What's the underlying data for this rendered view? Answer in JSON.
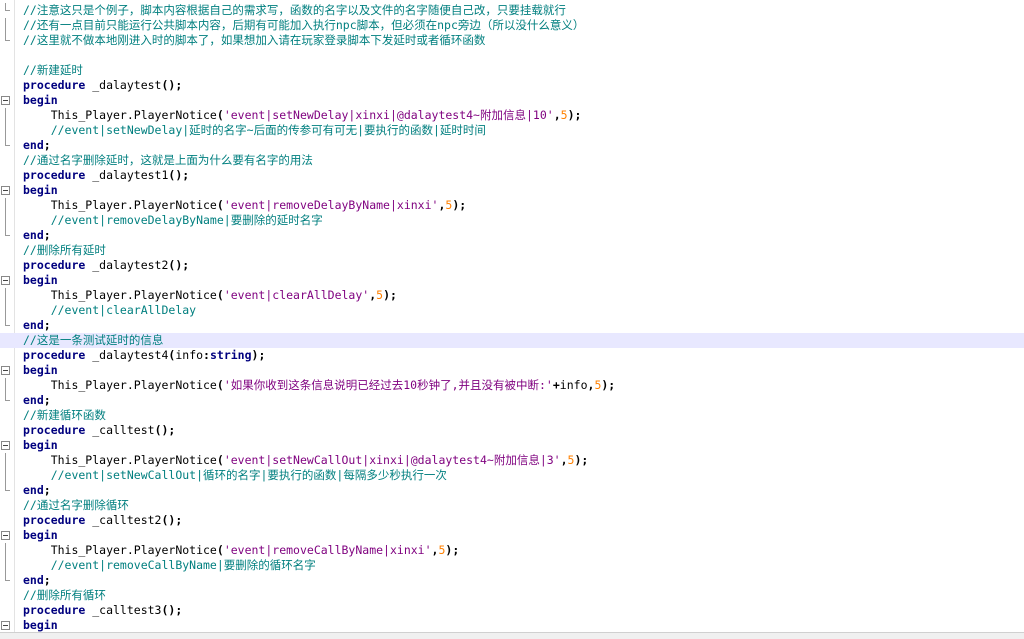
{
  "editor": {
    "lines": [
      {
        "fold": "corner",
        "hl": false,
        "tokens": [
          [
            "cm",
            "//注意这只是个例子，脚本内容根据自己的需求写，函数的名字以及文件的名字随便自己改，只要挂载就行"
          ]
        ]
      },
      {
        "fold": "bar",
        "hl": false,
        "tokens": [
          [
            "cm",
            "//还有一点目前只能运行公共脚本内容，后期有可能加入执行npc脚本，但必须在npc旁边（所以没什么意义）"
          ]
        ]
      },
      {
        "fold": "corner",
        "hl": false,
        "tokens": [
          [
            "cm",
            "//这里就不做本地刚进入时的脚本了，如果想加入请在玩家登录脚本下发延时或者循环函数"
          ]
        ]
      },
      {
        "fold": "",
        "hl": false,
        "tokens": []
      },
      {
        "fold": "",
        "hl": false,
        "tokens": [
          [
            "cm",
            "//新建延时"
          ]
        ]
      },
      {
        "fold": "",
        "hl": false,
        "tokens": [
          [
            "kw",
            "procedure"
          ],
          [
            "id",
            " _dalaytest"
          ],
          [
            "op",
            "();"
          ]
        ]
      },
      {
        "fold": "box",
        "hl": false,
        "tokens": [
          [
            "kw",
            "begin"
          ]
        ]
      },
      {
        "fold": "bar",
        "hl": false,
        "tokens": [
          [
            "id",
            "    This_Player.PlayerNotice"
          ],
          [
            "op",
            "("
          ],
          [
            "str",
            "'event|setNewDelay|xinxi|@dalaytest4~附加信息|10'"
          ],
          [
            "op",
            ","
          ],
          [
            "num",
            "5"
          ],
          [
            "op",
            ");"
          ]
        ]
      },
      {
        "fold": "bar",
        "hl": false,
        "tokens": [
          [
            "cm",
            "    //event|setNewDelay|延时的名字~后面的传参可有可无|要执行的函数|延时时间"
          ]
        ]
      },
      {
        "fold": "corner",
        "hl": false,
        "tokens": [
          [
            "kw",
            "end"
          ],
          [
            "op",
            ";"
          ]
        ]
      },
      {
        "fold": "",
        "hl": false,
        "tokens": [
          [
            "cm",
            "//通过名字删除延时，这就是上面为什么要有名字的用法"
          ]
        ]
      },
      {
        "fold": "",
        "hl": false,
        "tokens": [
          [
            "kw",
            "procedure"
          ],
          [
            "id",
            " _dalaytest1"
          ],
          [
            "op",
            "();"
          ]
        ]
      },
      {
        "fold": "box",
        "hl": false,
        "tokens": [
          [
            "kw",
            "begin"
          ]
        ]
      },
      {
        "fold": "bar",
        "hl": false,
        "tokens": [
          [
            "id",
            "    This_Player.PlayerNotice"
          ],
          [
            "op",
            "("
          ],
          [
            "str",
            "'event|removeDelayByName|xinxi'"
          ],
          [
            "op",
            ","
          ],
          [
            "num",
            "5"
          ],
          [
            "op",
            ");"
          ]
        ]
      },
      {
        "fold": "bar",
        "hl": false,
        "tokens": [
          [
            "cm",
            "    //event|removeDelayByName|要删除的延时名字"
          ]
        ]
      },
      {
        "fold": "corner",
        "hl": false,
        "tokens": [
          [
            "kw",
            "end"
          ],
          [
            "op",
            ";"
          ]
        ]
      },
      {
        "fold": "",
        "hl": false,
        "tokens": [
          [
            "cm",
            "//删除所有延时"
          ]
        ]
      },
      {
        "fold": "",
        "hl": false,
        "tokens": [
          [
            "kw",
            "procedure"
          ],
          [
            "id",
            " _dalaytest2"
          ],
          [
            "op",
            "();"
          ]
        ]
      },
      {
        "fold": "box",
        "hl": false,
        "tokens": [
          [
            "kw",
            "begin"
          ]
        ]
      },
      {
        "fold": "bar",
        "hl": false,
        "tokens": [
          [
            "id",
            "    This_Player.PlayerNotice"
          ],
          [
            "op",
            "("
          ],
          [
            "str",
            "'event|clearAllDelay'"
          ],
          [
            "op",
            ","
          ],
          [
            "num",
            "5"
          ],
          [
            "op",
            ");"
          ]
        ]
      },
      {
        "fold": "bar",
        "hl": false,
        "tokens": [
          [
            "cm",
            "    //event|clearAllDelay"
          ]
        ]
      },
      {
        "fold": "corner",
        "hl": false,
        "tokens": [
          [
            "kw",
            "end"
          ],
          [
            "op",
            ";"
          ]
        ]
      },
      {
        "fold": "",
        "hl": true,
        "tokens": [
          [
            "cm",
            "//这是一条测试延时的信息"
          ]
        ]
      },
      {
        "fold": "",
        "hl": false,
        "tokens": [
          [
            "kw",
            "procedure"
          ],
          [
            "id",
            " _dalaytest4"
          ],
          [
            "op",
            "("
          ],
          [
            "id",
            "info"
          ],
          [
            "op",
            ":"
          ],
          [
            "kw",
            "string"
          ],
          [
            "op",
            ");"
          ]
        ]
      },
      {
        "fold": "box",
        "hl": false,
        "tokens": [
          [
            "kw",
            "begin"
          ]
        ]
      },
      {
        "fold": "bar",
        "hl": false,
        "tokens": [
          [
            "id",
            "    This_Player.PlayerNotice"
          ],
          [
            "op",
            "("
          ],
          [
            "str",
            "'如果你收到这条信息说明已经过去10秒钟了,并且没有被中断:'"
          ],
          [
            "op",
            "+"
          ],
          [
            "id",
            "info"
          ],
          [
            "op",
            ","
          ],
          [
            "num",
            "5"
          ],
          [
            "op",
            ");"
          ]
        ]
      },
      {
        "fold": "corner",
        "hl": false,
        "tokens": [
          [
            "kw",
            "end"
          ],
          [
            "op",
            ";"
          ]
        ]
      },
      {
        "fold": "",
        "hl": false,
        "tokens": [
          [
            "cm",
            "//新建循环函数"
          ]
        ]
      },
      {
        "fold": "",
        "hl": false,
        "tokens": [
          [
            "kw",
            "procedure"
          ],
          [
            "id",
            " _calltest"
          ],
          [
            "op",
            "();"
          ]
        ]
      },
      {
        "fold": "box",
        "hl": false,
        "tokens": [
          [
            "kw",
            "begin"
          ]
        ]
      },
      {
        "fold": "bar",
        "hl": false,
        "tokens": [
          [
            "id",
            "    This_Player.PlayerNotice"
          ],
          [
            "op",
            "("
          ],
          [
            "str",
            "'event|setNewCallOut|xinxi|@dalaytest4~附加信息|3'"
          ],
          [
            "op",
            ","
          ],
          [
            "num",
            "5"
          ],
          [
            "op",
            ");"
          ]
        ]
      },
      {
        "fold": "bar",
        "hl": false,
        "tokens": [
          [
            "cm",
            "    //event|setNewCallOut|循环的名字|要执行的函数|每隔多少秒执行一次"
          ]
        ]
      },
      {
        "fold": "corner",
        "hl": false,
        "tokens": [
          [
            "kw",
            "end"
          ],
          [
            "op",
            ";"
          ]
        ]
      },
      {
        "fold": "",
        "hl": false,
        "tokens": [
          [
            "cm",
            "//通过名字删除循环"
          ]
        ]
      },
      {
        "fold": "",
        "hl": false,
        "tokens": [
          [
            "kw",
            "procedure"
          ],
          [
            "id",
            " _calltest2"
          ],
          [
            "op",
            "();"
          ]
        ]
      },
      {
        "fold": "box",
        "hl": false,
        "tokens": [
          [
            "kw",
            "begin"
          ]
        ]
      },
      {
        "fold": "bar",
        "hl": false,
        "tokens": [
          [
            "id",
            "    This_Player.PlayerNotice"
          ],
          [
            "op",
            "("
          ],
          [
            "str",
            "'event|removeCallByName|xinxi'"
          ],
          [
            "op",
            ","
          ],
          [
            "num",
            "5"
          ],
          [
            "op",
            ");"
          ]
        ]
      },
      {
        "fold": "bar",
        "hl": false,
        "tokens": [
          [
            "cm",
            "    //event|removeCallByName|要删除的循环名字"
          ]
        ]
      },
      {
        "fold": "corner",
        "hl": false,
        "tokens": [
          [
            "kw",
            "end"
          ],
          [
            "op",
            ";"
          ]
        ]
      },
      {
        "fold": "",
        "hl": false,
        "tokens": [
          [
            "cm",
            "//删除所有循环"
          ]
        ]
      },
      {
        "fold": "",
        "hl": false,
        "tokens": [
          [
            "kw",
            "procedure"
          ],
          [
            "id",
            " _calltest3"
          ],
          [
            "op",
            "();"
          ]
        ]
      },
      {
        "fold": "box",
        "hl": false,
        "tokens": [
          [
            "kw",
            "begin"
          ]
        ]
      }
    ]
  }
}
